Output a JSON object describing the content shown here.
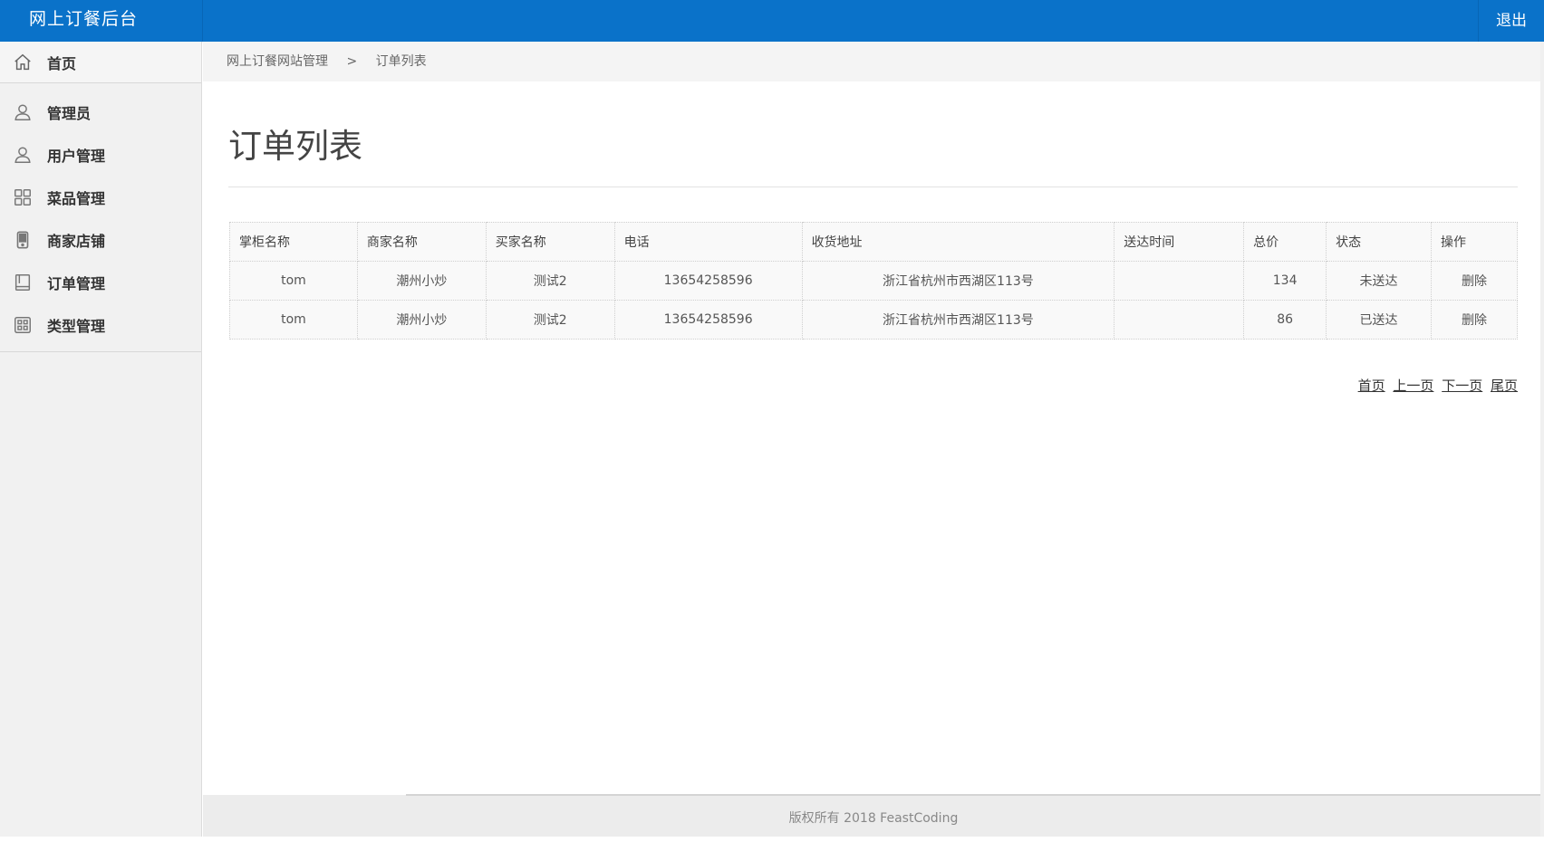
{
  "header": {
    "title": "网上订餐后台",
    "logout_label": "退出"
  },
  "sidebar": {
    "items": [
      {
        "label": "首页",
        "icon": "home-icon"
      },
      {
        "label": "管理员",
        "icon": "user-icon"
      },
      {
        "label": "用户管理",
        "icon": "user-icon"
      },
      {
        "label": "菜品管理",
        "icon": "grid-icon"
      },
      {
        "label": "商家店铺",
        "icon": "store-icon"
      },
      {
        "label": "订单管理",
        "icon": "book-icon"
      },
      {
        "label": "类型管理",
        "icon": "apps-icon"
      }
    ]
  },
  "breadcrumb": {
    "root": "网上订餐网站管理",
    "separator": ">",
    "current": "订单列表"
  },
  "page": {
    "title": "订单列表"
  },
  "table": {
    "headers": [
      "掌柜名称",
      "商家名称",
      "买家名称",
      "电话",
      "收货地址",
      "送达时间",
      "总价",
      "状态",
      "操作"
    ],
    "rows": [
      {
        "owner": "tom",
        "shop": "潮州小炒",
        "buyer": "测试2",
        "phone": "13654258596",
        "address": "浙江省杭州市西湖区113号",
        "time": "",
        "total": "134",
        "status": "未送达",
        "action": "删除"
      },
      {
        "owner": "tom",
        "shop": "潮州小炒",
        "buyer": "测试2",
        "phone": "13654258596",
        "address": "浙江省杭州市西湖区113号",
        "time": "",
        "total": "86",
        "status": "已送达",
        "action": "删除"
      }
    ]
  },
  "pager": {
    "first": "首页",
    "prev": "上一页",
    "next": "下一页",
    "last": "尾页"
  },
  "footer": {
    "text": "版权所有 2018 FeastCoding"
  },
  "colors": {
    "topbar": "#0a72c9",
    "sidebar": "#f1f1f1"
  }
}
